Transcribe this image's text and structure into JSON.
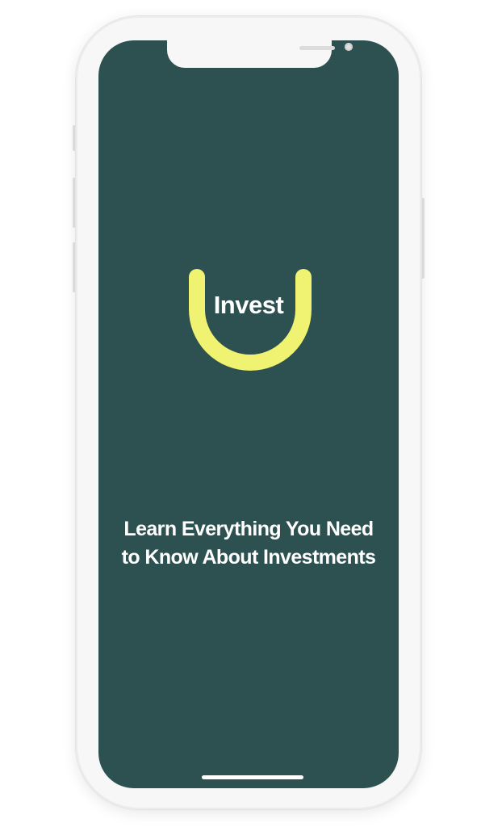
{
  "app": {
    "logo_text": "Invest",
    "logo_icon": "u-shaped-arc-logo"
  },
  "splash": {
    "tagline_line1": "Learn Everything You Need",
    "tagline_line2": "to Know About Investments"
  },
  "colors": {
    "background": "#2d5150",
    "logo_arc": "#f0f372",
    "text": "#ffffff",
    "device_frame": "#f7f7f7"
  }
}
